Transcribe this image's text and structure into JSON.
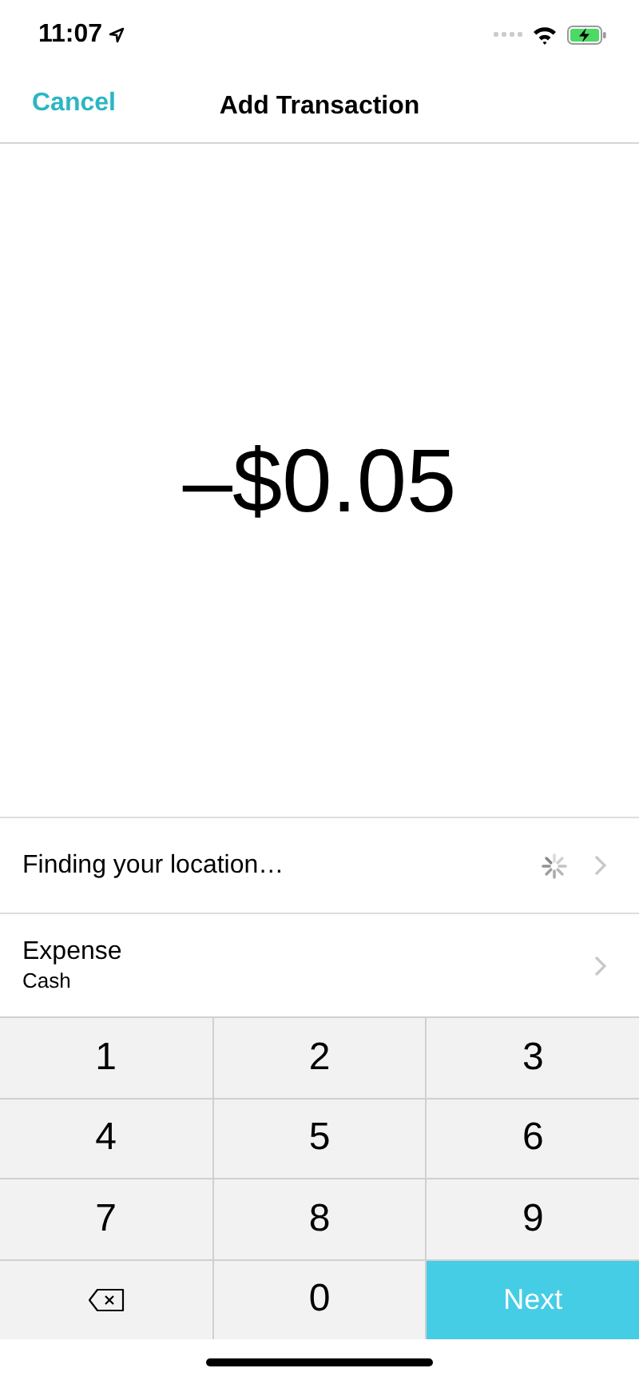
{
  "status_bar": {
    "time": "11:07"
  },
  "nav": {
    "cancel": "Cancel",
    "title": "Add Transaction"
  },
  "amount": "–$0.05",
  "rows": [
    {
      "kind": "location",
      "label": "Finding your location…",
      "loading": true
    },
    {
      "kind": "account",
      "label": "Expense",
      "detail": "Cash"
    }
  ],
  "keypad": [
    {
      "kind": "digit",
      "label": "1"
    },
    {
      "kind": "digit",
      "label": "2"
    },
    {
      "kind": "digit",
      "label": "3"
    },
    {
      "kind": "digit",
      "label": "4"
    },
    {
      "kind": "digit",
      "label": "5"
    },
    {
      "kind": "digit",
      "label": "6"
    },
    {
      "kind": "digit",
      "label": "7"
    },
    {
      "kind": "digit",
      "label": "8"
    },
    {
      "kind": "digit",
      "label": "9"
    },
    {
      "kind": "delete"
    },
    {
      "kind": "digit",
      "label": "0"
    },
    {
      "kind": "next",
      "label": "Next"
    }
  ]
}
